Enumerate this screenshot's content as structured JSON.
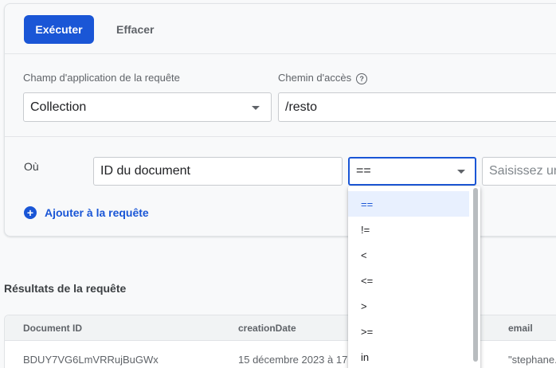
{
  "toolbar": {
    "run_label": "Exécuter",
    "clear_label": "Effacer"
  },
  "scope": {
    "label": "Champ d'application de la requête",
    "value": "Collection",
    "path_label": "Chemin d'accès",
    "path_value": "/resto",
    "help_glyph": "?"
  },
  "where": {
    "label": "Où",
    "field_value": "ID du document",
    "operator_value": "==",
    "value_placeholder": "Saisissez une valeur",
    "add_label": "Ajouter à la requête",
    "plus_glyph": "+"
  },
  "operators": [
    "==",
    "!=",
    "<",
    "<=",
    ">",
    ">=",
    "in"
  ],
  "results": {
    "title": "Résultats de la requête",
    "columns": [
      "Document ID",
      "creationDate",
      "email"
    ],
    "row": [
      "BDUY7VG6LmVRRujBuGWx",
      "15 décembre 2023 à 17:",
      "\"stephane."
    ]
  },
  "colors": {
    "accent": "#1a56d6",
    "selected_bg": "#e8f0fe"
  }
}
